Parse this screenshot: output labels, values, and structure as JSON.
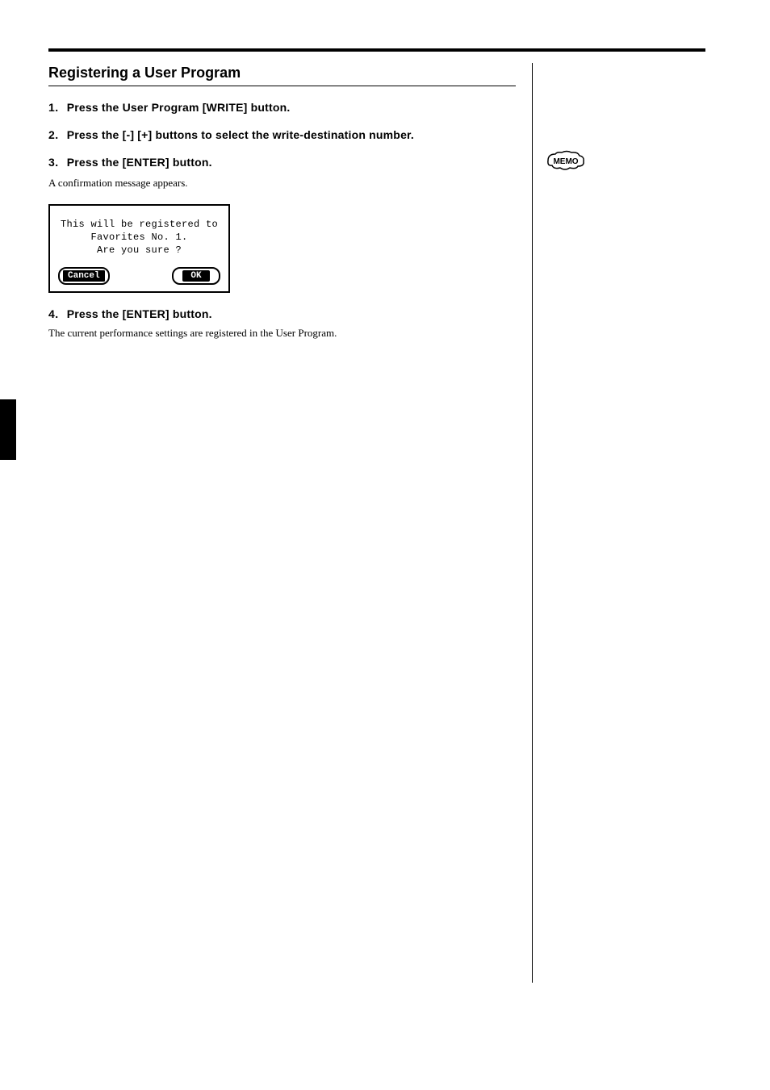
{
  "section_title": "Registering a User Program",
  "steps": [
    {
      "label": "1.",
      "text": "Press the User Program [WRITE] button.",
      "body": ""
    },
    {
      "label": "2.",
      "text": "Press the [-] [+] buttons to select the write-destination number.",
      "body": ""
    },
    {
      "label": "3.",
      "text": "Press the [ENTER] button.",
      "body": "A confirmation message appears."
    }
  ],
  "dialog": {
    "line1": "This will be registered to",
    "line2": "Favorites No. 1.",
    "line3": "Are you sure ?",
    "cancel": "Cancel",
    "ok": "OK"
  },
  "step4": {
    "label": "4.",
    "text": "Press the [ENTER] button.",
    "body": "The current performance settings are registered in the User Program."
  },
  "memo_note": "",
  "page_number": ""
}
